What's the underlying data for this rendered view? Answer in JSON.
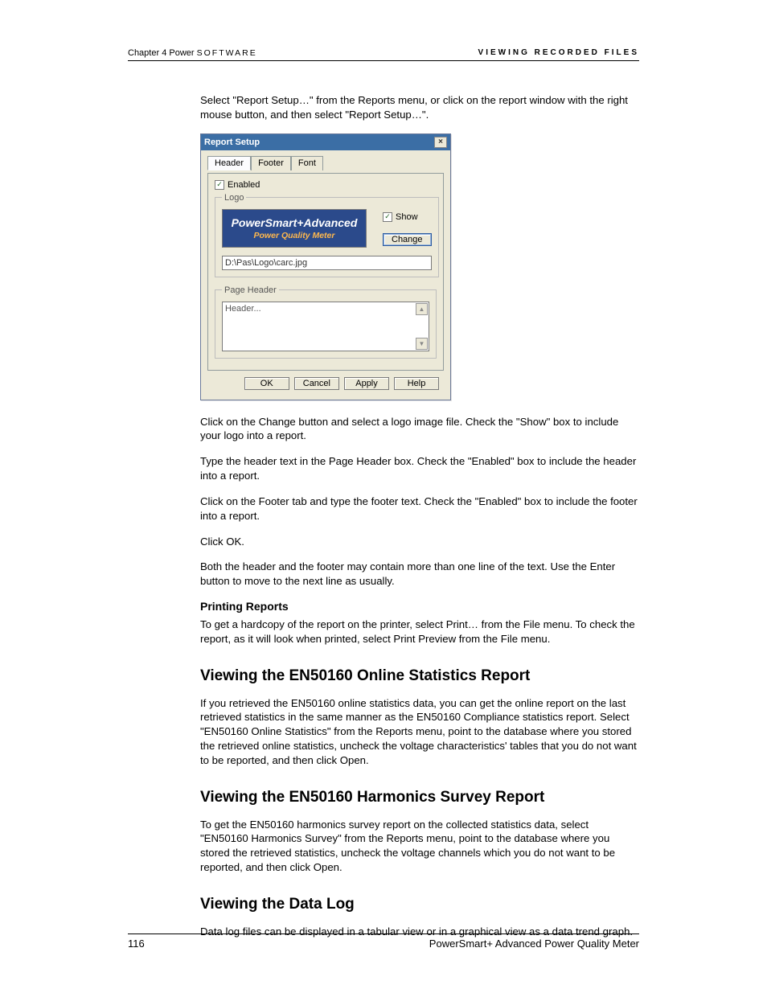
{
  "running_head": {
    "left_plain": "Chapter 4  Power ",
    "left_spaced": "SOFTWARE",
    "right": "VIEWING RECORDED FILES"
  },
  "paras": {
    "p1": "Select \"Report Setup…\" from the Reports menu, or click on the report window with the right mouse button, and then select \"Report Setup…\".",
    "p2": "Click on the Change button and select a logo image file. Check the \"Show\" box to include your logo into a report.",
    "p3": "Type the header text in the Page Header box. Check the \"Enabled\" box to include the header into a report.",
    "p4": "Click on the Footer tab and type the footer text. Check the \"Enabled\" box to include the footer into a report.",
    "p5": "Click OK.",
    "p6": "Both the header and the footer may contain more than one line of the text. Use the Enter button to move to the next line as usually.",
    "printing_h": "Printing Reports",
    "p7": "To get a hardcopy of the report on the printer, select Print… from the File menu. To check the report, as it will look when printed, select Print Preview from the File menu.",
    "h2a": "Viewing the EN50160 Online Statistics Report",
    "p8": "If you retrieved the EN50160 online statistics data, you can get the online report on the last retrieved statistics in the same manner as the EN50160 Compliance statistics report. Select \"EN50160 Online Statistics\" from the Reports menu, point to the database where you stored the retrieved online statistics, uncheck the voltage characteristics' tables that you do not want to be reported, and then click Open.",
    "h2b": "Viewing the EN50160 Harmonics Survey Report",
    "p9": "To get the EN50160 harmonics survey report on the collected statistics data, select \"EN50160 Harmonics Survey\" from the Reports menu, point to the database where you stored the retrieved statistics, uncheck the voltage channels which you do not want to be reported, and then click Open.",
    "h2c": "Viewing the Data Log",
    "p10": "Data log files can be displayed in a tabular view or in a graphical view as a data trend graph."
  },
  "dialog": {
    "title": "Report Setup",
    "tabs": {
      "header": "Header",
      "footer": "Footer",
      "font": "Font"
    },
    "enabled_label": "Enabled",
    "logo_group": "Logo",
    "logo_line1": "PowerSmart+Advanced",
    "logo_line2": "Power Quality Meter",
    "show_label": "Show",
    "change_btn": "Change",
    "path_value": "D:\\Pas\\Logo\\carc.jpg",
    "page_header_group": "Page Header",
    "header_placeholder": "Header...",
    "buttons": {
      "ok": "OK",
      "cancel": "Cancel",
      "apply": "Apply",
      "help": "Help"
    }
  },
  "footer": {
    "page_num": "116",
    "doc_title": "PowerSmart+ Advanced Power Quality Meter"
  }
}
